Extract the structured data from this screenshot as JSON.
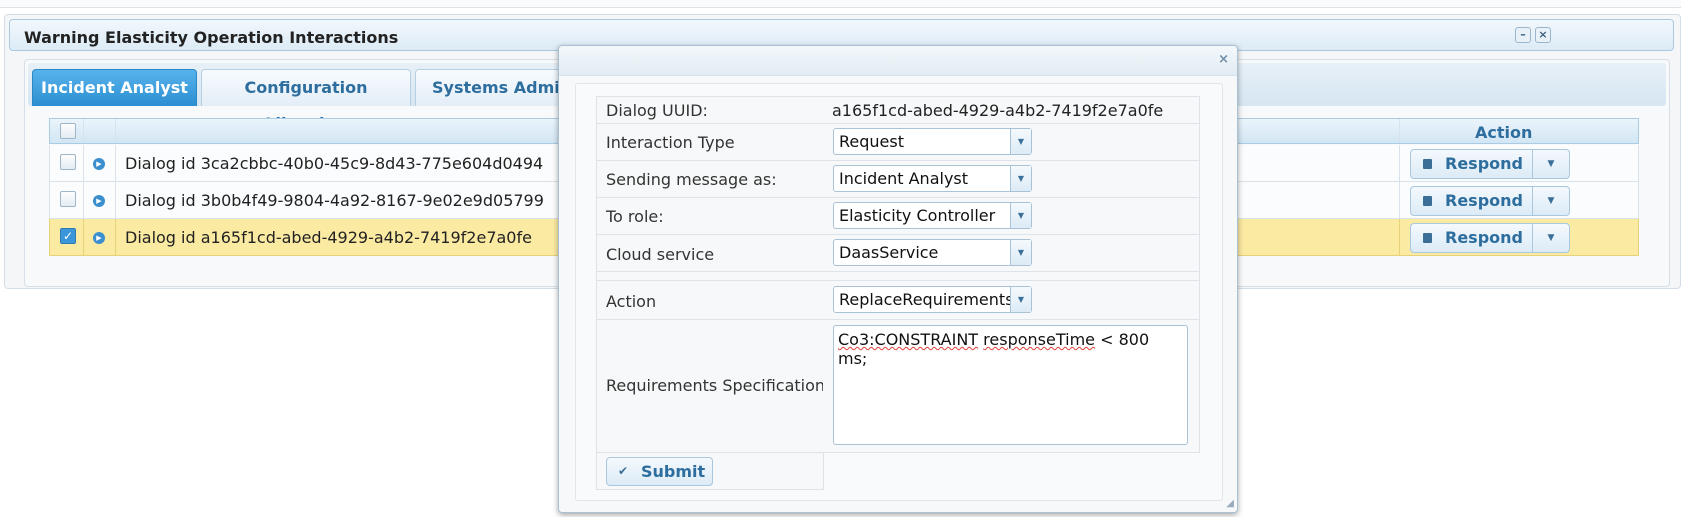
{
  "panel": {
    "title": "Warning Elasticity Operation Interactions",
    "minimize_icon": "minimize-icon",
    "close_icon": "close-icon"
  },
  "tabs": [
    {
      "label": "Incident Analyst",
      "active": true
    },
    {
      "label": "Configuration Librarian",
      "active": false
    },
    {
      "label": "Systems Admi",
      "active": false
    }
  ],
  "grid": {
    "action_header": "Action",
    "rows": [
      {
        "text": "Dialog id 3ca2cbbc-40b0-45c9-8d43-775e604d0494",
        "checked": false,
        "action": "Respond"
      },
      {
        "text": "Dialog id 3b0b4f49-9804-4a92-8167-9e02e9d05799",
        "checked": false,
        "action": "Respond"
      },
      {
        "text": "Dialog id a165f1cd-abed-4929-a4b2-7419f2e7a0fe",
        "checked": true,
        "action": "Respond"
      }
    ]
  },
  "dialog": {
    "close_icon": "close-icon",
    "uuid_label": "Dialog UUID:",
    "uuid_value": "a165f1cd-abed-4929-a4b2-7419f2e7a0fe",
    "interaction_type_label": "Interaction Type",
    "interaction_type_value": "Request",
    "sending_as_label": "Sending message as:",
    "sending_as_value": "Incident Analyst",
    "to_role_label": "To role:",
    "to_role_value": "Elasticity Controller",
    "cloud_service_label": "Cloud service",
    "cloud_service_value": "DaasService",
    "action_label": "Action",
    "action_value": "ReplaceRequirements",
    "requirements_label": "Requirements Specification",
    "requirements_text": {
      "w1": "Co3:CONSTRAINT",
      "w2": "responseTime",
      "rest": "< 800 ms;"
    },
    "submit_label": "Submit"
  },
  "colors": {
    "accent": "#2b8fd1",
    "selected_row": "#fbeaa2",
    "link_text": "#2e6e9e"
  }
}
